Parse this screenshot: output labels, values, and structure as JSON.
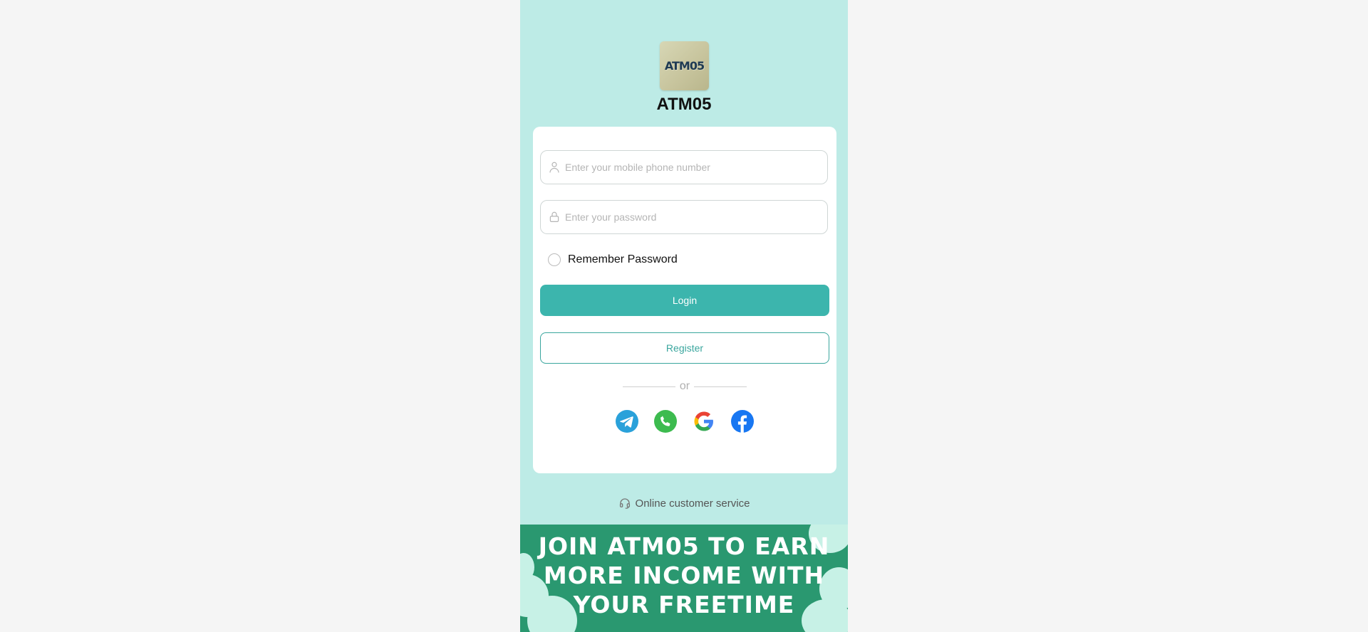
{
  "brand": {
    "name": "ATM05",
    "logo_text": "ATM05"
  },
  "form": {
    "phone_placeholder": "Enter your mobile phone number",
    "password_placeholder": "Enter your password",
    "remember_label": "Remember Password",
    "login_label": "Login",
    "register_label": "Register",
    "divider_text": "or"
  },
  "social_icons": [
    "telegram-icon",
    "whatsapp-icon",
    "google-icon",
    "facebook-icon"
  ],
  "support": {
    "label": "Online customer service"
  },
  "banner": {
    "text": "JOIN ATM05 TO EARN MORE INCOME WITH YOUR FREETIME"
  },
  "colors": {
    "page_bg": "#f5f5f5",
    "phone_bg": "#bdebe6",
    "primary": "#3cb5ad",
    "banner_bg": "#2a9870"
  }
}
